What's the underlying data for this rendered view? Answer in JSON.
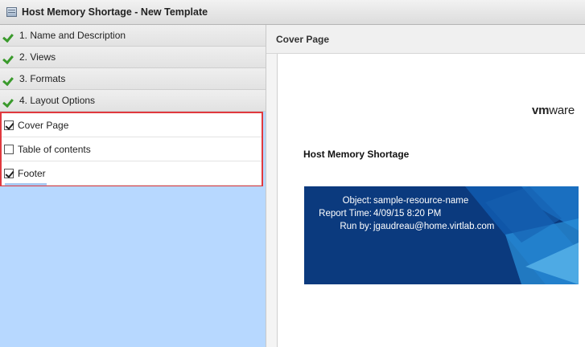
{
  "window": {
    "title": "Host Memory Shortage - New Template",
    "icon": "window-icon"
  },
  "steps": [
    {
      "label": "1. Name and Description",
      "completed": true
    },
    {
      "label": "2. Views",
      "completed": true
    },
    {
      "label": "3. Formats",
      "completed": true
    },
    {
      "label": "4. Layout Options",
      "completed": true
    }
  ],
  "layout_options": [
    {
      "label": "Cover Page",
      "checked": true
    },
    {
      "label": "Table of contents",
      "checked": false
    },
    {
      "label": "Footer",
      "checked": true
    }
  ],
  "preview": {
    "header": "Cover Page",
    "logo": {
      "bold": "vm",
      "rest": "ware"
    },
    "report_title": "Host Memory Shortage",
    "banner": {
      "object_label": "Object:",
      "object_value": "sample-resource-name",
      "time_label": "Report Time:",
      "time_value": "4/09/15 8:20 PM",
      "runby_label": "Run by:",
      "runby_value": "jgaudreau@home.virtlab.com"
    }
  },
  "colors": {
    "selection_bg": "#b7d8ff",
    "highlight_border": "#e0393e",
    "check_green": "#3a9a2c",
    "banner_blue": "#0b3a7e"
  }
}
